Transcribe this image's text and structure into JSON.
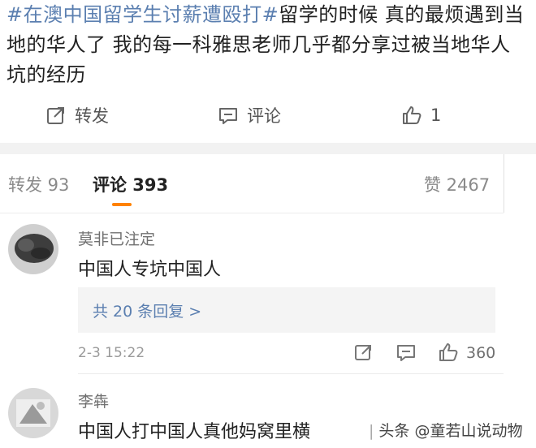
{
  "post": {
    "tag1": "#在澳中国留学生讨薪遭殴打#",
    "text": "留学的时候 真的最烦遇到当地的华人了 我的每一科雅思老师几乎都分享过被当地华人坑的经历"
  },
  "actions": {
    "repost_label": "转发",
    "comment_label": "评论",
    "like_count": "1"
  },
  "tabs": {
    "repost": "转发 93",
    "comment": "评论 393",
    "like": "赞 2467"
  },
  "comments": [
    {
      "username": "莫非已注定",
      "text": "中国人专坑中国人",
      "replies": "共 20 条回复 >",
      "time": "2-3 15:22",
      "likes": "360"
    },
    {
      "username": "李犇",
      "text": "中国人打中国人真他妈窝里横"
    }
  ],
  "watermark": {
    "sep": "|",
    "text": "头条 @童若山说动物"
  },
  "colors": {
    "link": "#5b7fb0",
    "accent": "#ff8200"
  }
}
